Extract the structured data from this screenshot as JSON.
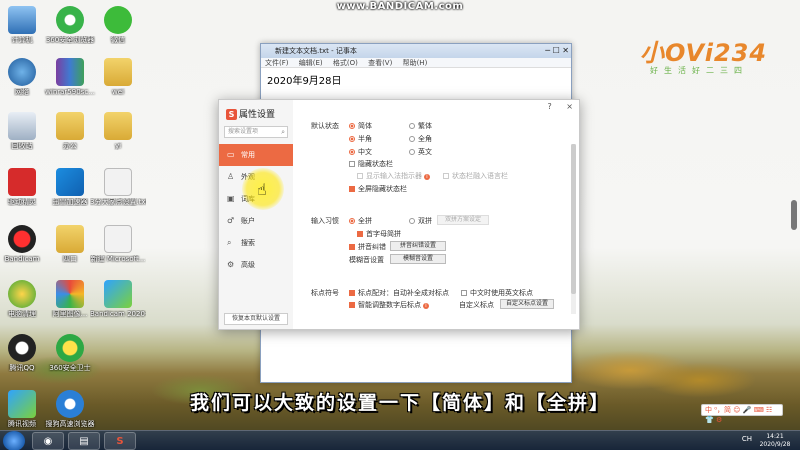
{
  "watermark": "www.BANDICAM.com",
  "logo": {
    "big": "小OVi234",
    "small": "好生活好二三四"
  },
  "desktop_icons": [
    {
      "label": "计算机"
    },
    {
      "label": "360安全浏览器"
    },
    {
      "label": "微信"
    },
    {
      "label": "网络"
    },
    {
      "label": "winrar590sc..."
    },
    {
      "label": "wei"
    },
    {
      "label": "回收站"
    },
    {
      "label": "办公"
    },
    {
      "label": "yi"
    },
    {
      "label": "驱动精灵"
    },
    {
      "label": "迅雷加速器"
    },
    {
      "label": "3分大家点设置.txt"
    },
    {
      "label": "Bandicam"
    },
    {
      "label": "四口"
    },
    {
      "label": "新建 Microsoft..."
    },
    {
      "label": "电脑清理"
    },
    {
      "label": "阿里图像..."
    },
    {
      "label": "Bandicam 2020-09-2..."
    },
    {
      "label": "腾讯QQ"
    },
    {
      "label": "360安全卫士"
    },
    {
      "label": "腾讯视频"
    },
    {
      "label": "搜狗高速浏览器"
    }
  ],
  "notepad": {
    "title": "新建文本文档.txt - 记事本",
    "menu": [
      "文件(F)",
      "编辑(E)",
      "格式(O)",
      "查看(V)",
      "帮助(H)"
    ],
    "content": "2020年9月28日"
  },
  "dialog": {
    "title": "属性设置",
    "search_placeholder": "搜索设置项",
    "nav": [
      {
        "label": "常用",
        "icon": "monitor-icon"
      },
      {
        "label": "外观",
        "icon": "shirt-icon"
      },
      {
        "label": "词库",
        "icon": "book-icon"
      },
      {
        "label": "账户",
        "icon": "user-icon"
      },
      {
        "label": "搜索",
        "icon": "search-icon"
      },
      {
        "label": "高级",
        "icon": "gear-icon"
      }
    ],
    "reset_label": "恢复本页默认设置",
    "controls": {
      "help": "?",
      "close": "×"
    },
    "default_state": {
      "label": "默认状态",
      "simp": "简体",
      "trad": "繁体",
      "half": "半角",
      "full": "全角",
      "cn": "中文",
      "en": "英文",
      "hide_bar": "隐藏状态栏",
      "show_ime": "显示输入法指示器",
      "bar_in_lang": "状态栏融入语言栏",
      "fullscreen_hide": "全屏隐藏状态栏"
    },
    "input_habit": {
      "label": "输入习惯",
      "full_pinyin": "全拼",
      "double_pinyin": "双拼",
      "double_scheme_btn": "双拼方案设定",
      "initial_abbr": "首字母简拼",
      "pinyin_correct": "拼音纠错",
      "pinyin_correct_btn": "拼音纠错设置",
      "fuzzy_label": "模糊音设置",
      "fuzzy_btn": "模糊音设置"
    },
    "punctuation": {
      "label": "标点符号",
      "auto_pair": "标点配对：自动补全成对标点",
      "cn_use_en": "中文时使用英文标点",
      "smart_adjust": "智能调整数字后标点",
      "custom_label": "自定义标点",
      "custom_btn": "自定义标点设置"
    }
  },
  "subtitle": "我们可以大致的设置一下【简体】和【全拼】",
  "taskbar": {
    "ime": "中 ⁰，简 ☺ 🎤 ⌨ ☷ 👕 ⚙",
    "tray": "CH",
    "time": "14:21",
    "date": "2020/9/28"
  }
}
